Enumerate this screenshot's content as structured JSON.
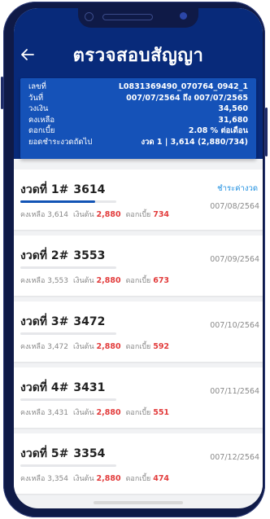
{
  "header": {
    "title": "ตรวจสอบสัญญา",
    "back_icon": "arrow-left-icon"
  },
  "contract": {
    "rows": [
      {
        "label": "เลขที่",
        "value": "L0831369490_070764_0942_1"
      },
      {
        "label": "วันที่",
        "value": "007/07/2564 ถึง 007/07/2565"
      },
      {
        "label": "วงเงิน",
        "value": "34,560"
      },
      {
        "label": "คงเหลือ",
        "value": "31,680"
      },
      {
        "label": "ดอกเบี้ย",
        "value": "2.08 % ต่อเดือน"
      },
      {
        "label": "ยอดชำระงวดถัดไป",
        "value": "งวด 1 | 3,614 (2,880/734)"
      }
    ]
  },
  "installments": [
    {
      "title": "งวดที่ 1#",
      "amount": "3614",
      "remaining_label": "คงเหลือ",
      "remaining": "3,614",
      "principal_label": "เงินต้น",
      "principal": "2,880",
      "interest_label": "ดอกเบี้ย",
      "interest": "734",
      "date": "007/08/2564",
      "progress": 0.78,
      "pay_label": "ชำระค่างวด"
    },
    {
      "title": "งวดที่ 2#",
      "amount": "3553",
      "remaining_label": "คงเหลือ",
      "remaining": "3,553",
      "principal_label": "เงินต้น",
      "principal": "2,880",
      "interest_label": "ดอกเบี้ย",
      "interest": "673",
      "date": "007/09/2564",
      "progress": 0
    },
    {
      "title": "งวดที่ 3#",
      "amount": "3472",
      "remaining_label": "คงเหลือ",
      "remaining": "3,472",
      "principal_label": "เงินต้น",
      "principal": "2,880",
      "interest_label": "ดอกเบี้ย",
      "interest": "592",
      "date": "007/10/2564",
      "progress": 0
    },
    {
      "title": "งวดที่ 4#",
      "amount": "3431",
      "remaining_label": "คงเหลือ",
      "remaining": "3,431",
      "principal_label": "เงินต้น",
      "principal": "2,880",
      "interest_label": "ดอกเบี้ย",
      "interest": "551",
      "date": "007/11/2564",
      "progress": 0
    },
    {
      "title": "งวดที่ 5#",
      "amount": "3354",
      "remaining_label": "คงเหลือ",
      "remaining": "3,354",
      "principal_label": "เงินต้น",
      "principal": "2,880",
      "interest_label": "ดอกเบี้ย",
      "interest": "474",
      "date": "007/12/2564",
      "progress": 0
    }
  ],
  "colors": {
    "header_bg": "#082a7a",
    "card_bg": "#1552b8",
    "accent_blue": "#1254b5",
    "interest_red": "#e23b3b",
    "link_blue": "#1e8fe0"
  }
}
